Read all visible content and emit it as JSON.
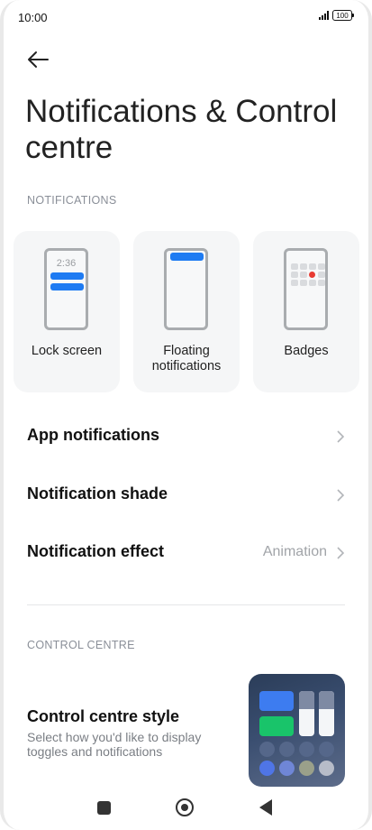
{
  "status_bar": {
    "time": "10:00",
    "battery": "100"
  },
  "header": {
    "back_icon": "arrow-left-icon",
    "title": "Notifications & Control centre"
  },
  "notifications_section": {
    "label": "NOTIFICATIONS",
    "cards": [
      {
        "label": "Lock screen",
        "lock_time": "2:36",
        "icon": "lock-screen-preview"
      },
      {
        "label": "Floating notifications",
        "icon": "floating-notification-preview"
      },
      {
        "label": "Badges",
        "icon": "badges-preview"
      }
    ],
    "rows": [
      {
        "label": "App notifications",
        "value": ""
      },
      {
        "label": "Notification shade",
        "value": ""
      },
      {
        "label": "Notification effect",
        "value": "Animation"
      }
    ]
  },
  "control_centre_section": {
    "label": "CONTROL CENTRE",
    "style_title": "Control centre style",
    "style_description": "Select how you'd like to display toggles and notifications"
  },
  "colors": {
    "accent_blue": "#1e7bf2",
    "badge_red": "#e83b33",
    "tile_green": "#19c46a"
  },
  "nav_bar": {
    "icons": [
      "recents-square-icon",
      "home-circle-icon",
      "back-triangle-icon"
    ]
  }
}
